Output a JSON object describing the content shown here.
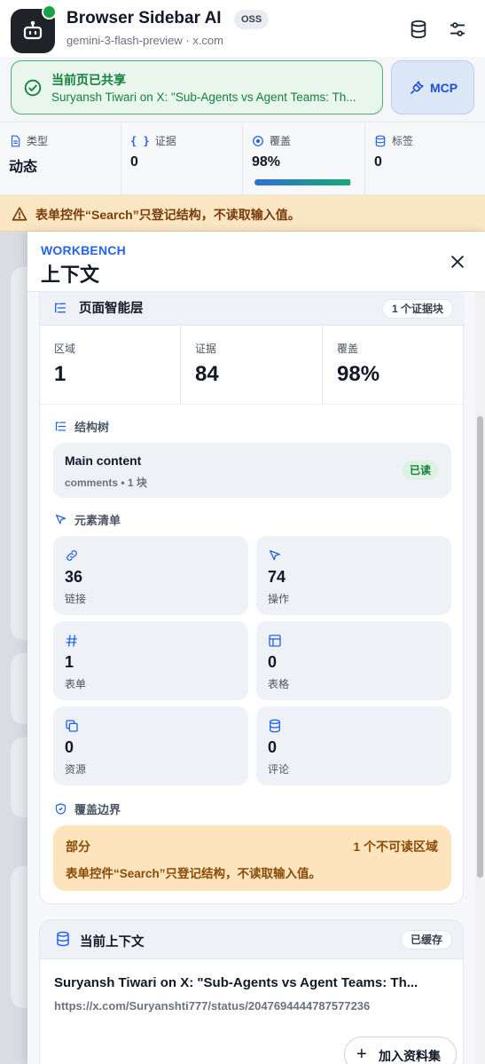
{
  "header": {
    "title": "Browser Sidebar AI",
    "badge": "OSS",
    "subtitle": "gemini-3-flash-preview · x.com",
    "icons": [
      "database-icon",
      "sliders-icon"
    ]
  },
  "share": {
    "title": "当前页已共享",
    "text": "Suryansh Tiwari on X: \"Sub-Agents vs Agent Teams: Th..."
  },
  "mcp_button": {
    "label": "MCP"
  },
  "stats": {
    "type": {
      "label": "类型",
      "value": "动态"
    },
    "evidence": {
      "label": "证据",
      "value": "0"
    },
    "coverage": {
      "label": "覆盖",
      "value": "98%",
      "fraction": 0.98
    },
    "tags": {
      "label": "标签",
      "value": "0"
    }
  },
  "warning": {
    "text": "表单控件“Search”只登记结构，不读取输入值。"
  },
  "drawer": {
    "eyebrow": "WORKBENCH",
    "title": "上下文",
    "intel": {
      "title": "页面智能层",
      "badge": "1 个证据块",
      "metrics": [
        {
          "label": "区域",
          "value": "1"
        },
        {
          "label": "证据",
          "value": "84"
        },
        {
          "label": "覆盖",
          "value": "98%"
        }
      ],
      "tree_label": "结构树",
      "tree_item": {
        "name": "Main content",
        "meta": "comments • 1 块",
        "badge": "已读"
      },
      "elements_label": "元素清单",
      "elements": [
        {
          "value": "36",
          "label": "链接",
          "icon": "link-icon"
        },
        {
          "value": "74",
          "label": "操作",
          "icon": "cursor-icon"
        },
        {
          "value": "1",
          "label": "表单",
          "icon": "hash-icon"
        },
        {
          "value": "0",
          "label": "表格",
          "icon": "table-icon"
        },
        {
          "value": "0",
          "label": "资源",
          "icon": "copy-icon"
        },
        {
          "value": "0",
          "label": "评论",
          "icon": "database-icon"
        }
      ],
      "boundary_label": "覆盖边界",
      "boundary": {
        "label": "部分",
        "count": "1 个不可读区域",
        "text": "表单控件“Search”只登记结构，不读取输入值。"
      }
    },
    "context": {
      "title": "当前上下文",
      "badge": "已缓存",
      "page_title": "Suryansh Tiwari on X: \"Sub-Agents vs Agent Teams: Th...",
      "url": "https://x.com/Suryanshti777/status/2047694444787577236",
      "add_button": "加入资料集"
    }
  }
}
